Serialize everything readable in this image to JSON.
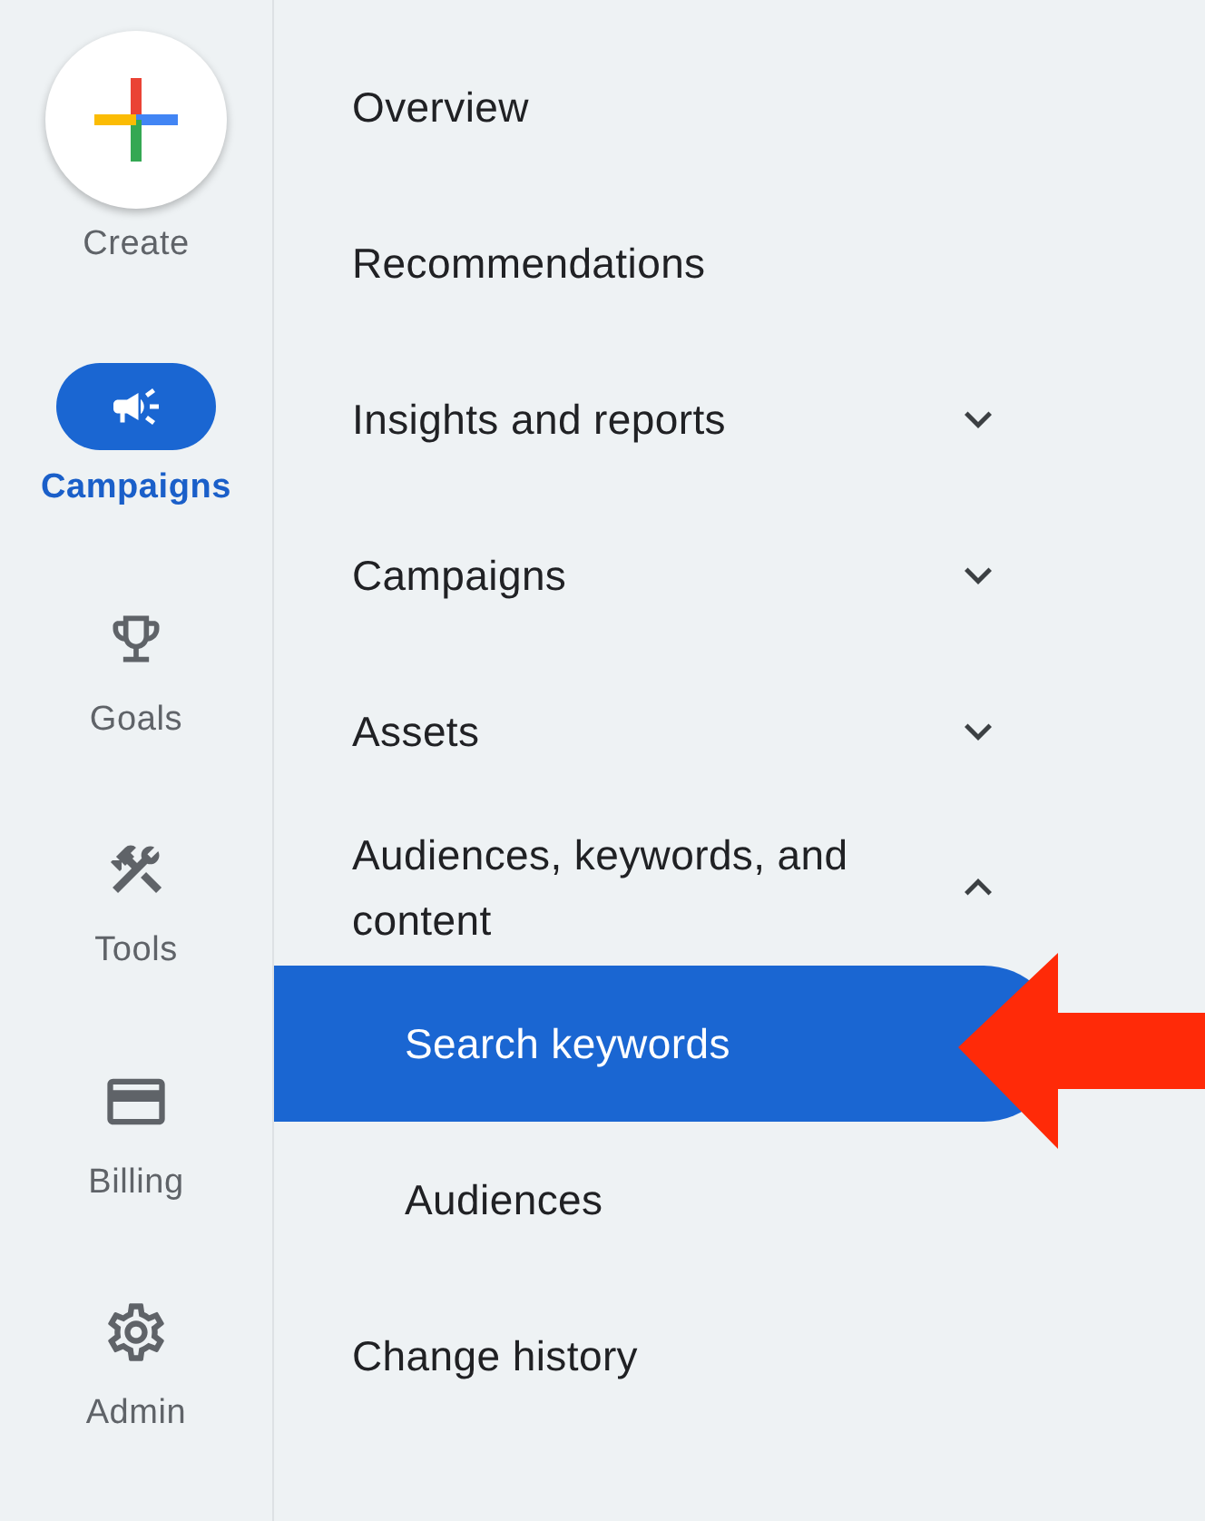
{
  "create": {
    "label": "Create"
  },
  "rail": [
    {
      "kind": "campaigns",
      "label": "Campaigns",
      "selected": true
    },
    {
      "kind": "goals",
      "label": "Goals",
      "selected": false
    },
    {
      "kind": "tools",
      "label": "Tools",
      "selected": false
    },
    {
      "kind": "billing",
      "label": "Billing",
      "selected": false
    },
    {
      "kind": "admin",
      "label": "Admin",
      "selected": false
    }
  ],
  "nav": [
    {
      "label": "Overview",
      "selected": false
    },
    {
      "label": "Recommendations",
      "selected": false
    },
    {
      "label": "Insights and reports",
      "selected": false,
      "expanded": false
    },
    {
      "label": "Campaigns",
      "selected": false,
      "expanded": false
    },
    {
      "label": "Assets",
      "selected": false,
      "expanded": false
    },
    {
      "label": "Audiences, keywords, and content",
      "selected": false,
      "expanded": true,
      "children": [
        {
          "label": "Search keywords",
          "selected": true
        },
        {
          "label": "Audiences",
          "selected": false
        }
      ]
    },
    {
      "label": "Change history",
      "selected": false
    }
  ]
}
